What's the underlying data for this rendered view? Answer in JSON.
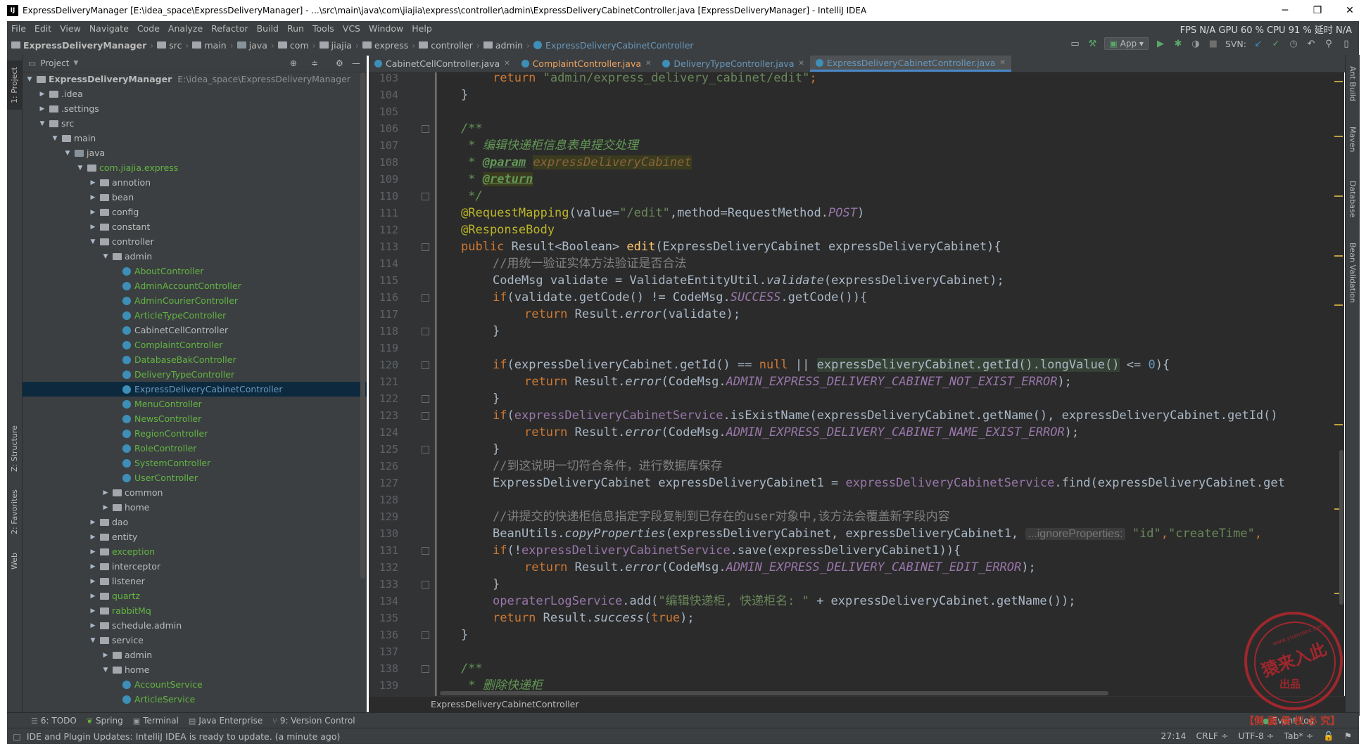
{
  "window": {
    "app_icon": "IJ",
    "title": "ExpressDeliveryManager [E:\\idea_space\\ExpressDeliveryManager] - ...\\src\\main\\java\\com\\jiajia\\express\\controller\\admin\\ExpressDeliveryCabinetController.java [ExpressDeliveryManager] - IntelliJ IDEA",
    "minimize": "─",
    "maximize": "❐",
    "close": "✕"
  },
  "menu": {
    "items": [
      "File",
      "Edit",
      "View",
      "Navigate",
      "Code",
      "Analyze",
      "Refactor",
      "Build",
      "Run",
      "Tools",
      "VCS",
      "Window",
      "Help"
    ],
    "perf": "FPS  N/A  GPU  60 %  CPU  91 %  延时  N/A"
  },
  "navbar": {
    "crumbs": [
      "ExpressDeliveryManager",
      "src",
      "main",
      "java",
      "com",
      "jiajia",
      "express",
      "controller",
      "admin",
      "ExpressDeliveryCabinetController"
    ],
    "run_config": "App",
    "svn_label": "SVN:"
  },
  "left_strip": {
    "project": "1: Project",
    "structure": "Z: Structure",
    "favorites": "2: Favorites",
    "web": "Web"
  },
  "right_strip": {
    "ant": "Ant Build",
    "maven": "Maven",
    "database": "Database",
    "bean": "Bean Validation"
  },
  "project_panel": {
    "header": "Project",
    "rows": [
      {
        "label": "ExpressDeliveryManager",
        "extra": "E:\\idea_space\\ExpressDeliveryManager",
        "arrow": "▼"
      },
      {
        "label": ".idea",
        "arrow": "▶"
      },
      {
        "label": ".settings",
        "arrow": "▶"
      },
      {
        "label": "src",
        "arrow": "▼"
      },
      {
        "label": "main",
        "arrow": "▼"
      },
      {
        "label": "java",
        "arrow": "▼"
      },
      {
        "label": "com.jiajia.express",
        "arrow": "▼"
      },
      {
        "label": "annotion",
        "arrow": "▶"
      },
      {
        "label": "bean",
        "arrow": "▶"
      },
      {
        "label": "config",
        "arrow": "▶"
      },
      {
        "label": "constant",
        "arrow": "▶"
      },
      {
        "label": "controller",
        "arrow": "▼"
      },
      {
        "label": "admin",
        "arrow": "▼"
      },
      {
        "label": "AboutController",
        "arrow": ""
      },
      {
        "label": "AdminAccountController",
        "arrow": ""
      },
      {
        "label": "AdminCourierController",
        "arrow": ""
      },
      {
        "label": "ArticleTypeController",
        "arrow": ""
      },
      {
        "label": "CabinetCellController",
        "arrow": ""
      },
      {
        "label": "ComplaintController",
        "arrow": ""
      },
      {
        "label": "DatabaseBakController",
        "arrow": ""
      },
      {
        "label": "DeliveryTypeController",
        "arrow": ""
      },
      {
        "label": "ExpressDeliveryCabinetController",
        "arrow": ""
      },
      {
        "label": "MenuController",
        "arrow": ""
      },
      {
        "label": "NewsController",
        "arrow": ""
      },
      {
        "label": "RegionController",
        "arrow": ""
      },
      {
        "label": "RoleController",
        "arrow": ""
      },
      {
        "label": "SystemController",
        "arrow": ""
      },
      {
        "label": "UserController",
        "arrow": ""
      },
      {
        "label": "common",
        "arrow": "▶"
      },
      {
        "label": "home",
        "arrow": "▶"
      },
      {
        "label": "dao",
        "arrow": "▶"
      },
      {
        "label": "entity",
        "arrow": "▶"
      },
      {
        "label": "exception",
        "arrow": "▶"
      },
      {
        "label": "interceptor",
        "arrow": "▶"
      },
      {
        "label": "listener",
        "arrow": "▶"
      },
      {
        "label": "quartz",
        "arrow": "▶"
      },
      {
        "label": "rabbitMq",
        "arrow": "▶"
      },
      {
        "label": "schedule.admin",
        "arrow": "▶"
      },
      {
        "label": "service",
        "arrow": "▼"
      },
      {
        "label": "admin",
        "arrow": "▶"
      },
      {
        "label": "home",
        "arrow": "▼"
      },
      {
        "label": "AccountService",
        "arrow": ""
      },
      {
        "label": "ArticleService",
        "arrow": ""
      }
    ]
  },
  "tabs": [
    "CabinetCellController.java",
    "ComplaintController.java",
    "DeliveryTypeController.java",
    "ExpressDeliveryCabinetController.java"
  ],
  "editor": {
    "line_numbers": [
      "103",
      "104",
      "105",
      "106",
      "107",
      "108",
      "109",
      "110",
      "111",
      "112",
      "113",
      "114",
      "115",
      "116",
      "117",
      "118",
      "119",
      "120",
      "121",
      "122",
      "123",
      "124",
      "125",
      "126",
      "127",
      "128",
      "129",
      "130",
      "131",
      "132",
      "133",
      "134",
      "135",
      "136",
      "137",
      "138",
      "139"
    ],
    "t": {
      "l103a": "return",
      "l103b": "\"admin/express_delivery_cabinet/edit\"",
      "l103c": ";",
      "l104": "}",
      "l106": "/**",
      "l107": " * 编辑快递柜信息表单提交处理",
      "l108a": " * ",
      "l108b": "@param",
      "l108c": "expressDeliveryCabinet",
      "l109a": " * ",
      "l109b": "@return",
      "l110": " */",
      "l111a": "@RequestMapping",
      "l111b": "(value=",
      "l111c": "\"/edit\"",
      "l111d": ",method=RequestMethod.",
      "l111e": "POST",
      ")": ")",
      "l112": "@ResponseBody",
      "l113a": "public",
      "l113b": " Result<Boolean> ",
      "l113c": "edit",
      "l113d": "(ExpressDeliveryCabinet expressDeliveryCabinet){",
      "l114": "//用统一验证实体方法验证是否合法",
      "l115a": "CodeMsg validate = ValidateEntityUtil.",
      "l115b": "validate",
      "l115c": "(expressDeliveryCabinet);",
      "l116a": "if",
      "l116b": "(validate.getCode() != CodeMsg.",
      "l116c": "SUCCESS",
      "l116d": ".getCode()){",
      "l117a": "return",
      "l117b": " Result.",
      "l117c": "error",
      "l117d": "(validate);",
      "l118": "}",
      "l120a": "if",
      "l120b": "(expressDeliveryCabinet.getId() == ",
      "l120c": "null",
      "l120d": " || ",
      "l120e": "expressDeliveryCabinet.getId().longValue()",
      "l120f": " <= ",
      "l120g": "0",
      "l120h": "){",
      "l121a": "return",
      "l121b": " Result.",
      "l121c": "error",
      "l121d": "(CodeMsg.",
      "l121e": "ADMIN_EXPRESS_DELIVERY_CABINET_NOT_EXIST_ERROR",
      "l121f": ");",
      "l122": "}",
      "l123a": "if",
      "l123b": "(",
      "l123c": "expressDeliveryCabinetService",
      "l123d": ".isExistName(expressDeliveryCabinet.getName(), expressDeliveryCabinet.getId()",
      "l124a": "return",
      "l124b": " Result.",
      "l124c": "error",
      "l124d": "(CodeMsg.",
      "l124e": "ADMIN_EXPRESS_DELIVERY_CABINET_NAME_EXIST_ERROR",
      "l124f": ");",
      "l125": "}",
      "l126": "//到这说明一切符合条件，进行数据库保存",
      "l127a": "ExpressDeliveryCabinet expressDeliveryCabinet1 = ",
      "l127b": "expressDeliveryCabinetService",
      "l127c": ".find(expressDeliveryCabinet.get",
      "l129": "//讲提交的快递柜信息指定字段复制到已存在的user对象中,该方法会覆盖新字段内容",
      "l130a": "BeanUtils.",
      "l130b": "copyProperties",
      "l130c": "(expressDeliveryCabinet, expressDeliveryCabinet1, ",
      "l130d": "...ignoreProperties:",
      "l130e": " \"id\"",
      "l130f": ",",
      "l130g": "\"createTime\"",
      ",": ",",
      "l131a": "if",
      "l131b": "(!",
      "l131c": "expressDeliveryCabinetService",
      "l131d": ".save(expressDeliveryCabinet1)){",
      "l132a": "return",
      "l132b": " Result.",
      "l132c": "error",
      "l132d": "(CodeMsg.",
      "l132e": "ADMIN_EXPRESS_DELIVERY_CABINET_EDIT_ERROR",
      "l132f": ");",
      "l133": "}",
      "l134a": "operaterLogService",
      "l134b": ".add(",
      "l134c": "\"编辑快递柜, 快递柜名: \"",
      "l134d": " + expressDeliveryCabinet.getName());",
      "l135a": "return",
      "l135b": " Result.",
      "l135c": "success",
      "l135d": "(",
      "l135e": "true",
      "l135f": ");",
      "l136": "}",
      "l138": "/**",
      "l139": " * 删除快递柜"
    },
    "breadcrumb": "ExpressDeliveryCabinetController"
  },
  "bottom_tabs": [
    "6: TODO",
    "Spring",
    "Terminal",
    "Java Enterprise",
    "9: Version Control"
  ],
  "event_log": "Event Log",
  "status": {
    "message": "IDE and Plugin Updates: IntelliJ IDEA is ready to update. (a minute ago)",
    "position": "27:14",
    "line_sep": "CRLF ÷",
    "encoding": "UTF-8 ÷",
    "indent": "Tab* ÷"
  },
  "watermark": {
    "url": "www.yuanrenc.com",
    "main": "猿来入此",
    "sub": "出品",
    "caption": "【侧 面 侵 权 必 究】"
  }
}
